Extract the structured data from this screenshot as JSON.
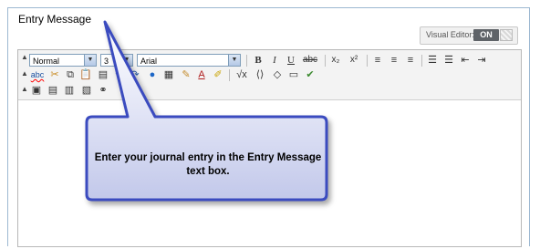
{
  "title": "Entry Message",
  "visual_editor": {
    "label": "Visual Editor:",
    "state": "ON"
  },
  "toolbar": {
    "format_select": "Normal",
    "size_select": "3",
    "font_select": "Arial",
    "bold": "B",
    "italic": "I",
    "underline": "U",
    "strike": "abc",
    "subscript": "x₂",
    "superscript": "x²"
  },
  "callout": {
    "text": "Enter your journal entry in the Entry Message text box."
  }
}
